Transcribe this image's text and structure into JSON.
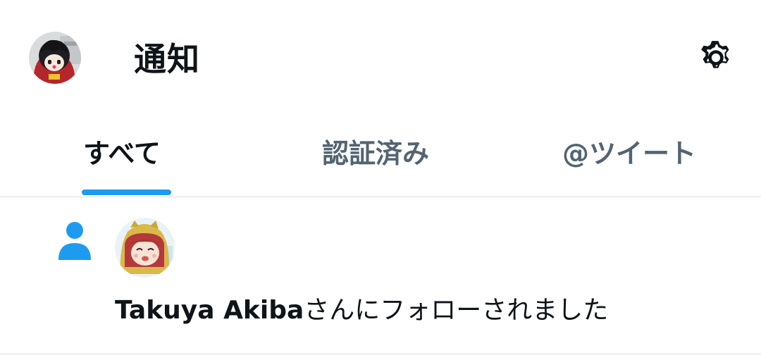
{
  "header": {
    "title": "通知",
    "avatar_icon": "user-avatar-icon",
    "settings_icon": "gear-icon"
  },
  "tabs": [
    {
      "label": "すべて",
      "active": true
    },
    {
      "label": "認証済み",
      "active": false
    },
    {
      "label": "@ツイート",
      "active": false
    }
  ],
  "notification": {
    "type_icon": "person-icon",
    "user_name": "Takuya Akiba",
    "message_suffix": "さんにフォローされました"
  },
  "colors": {
    "accent": "#1d9bf0",
    "primary_text": "#0f1419",
    "secondary_text": "#536471",
    "divider": "#dcdfe2"
  }
}
